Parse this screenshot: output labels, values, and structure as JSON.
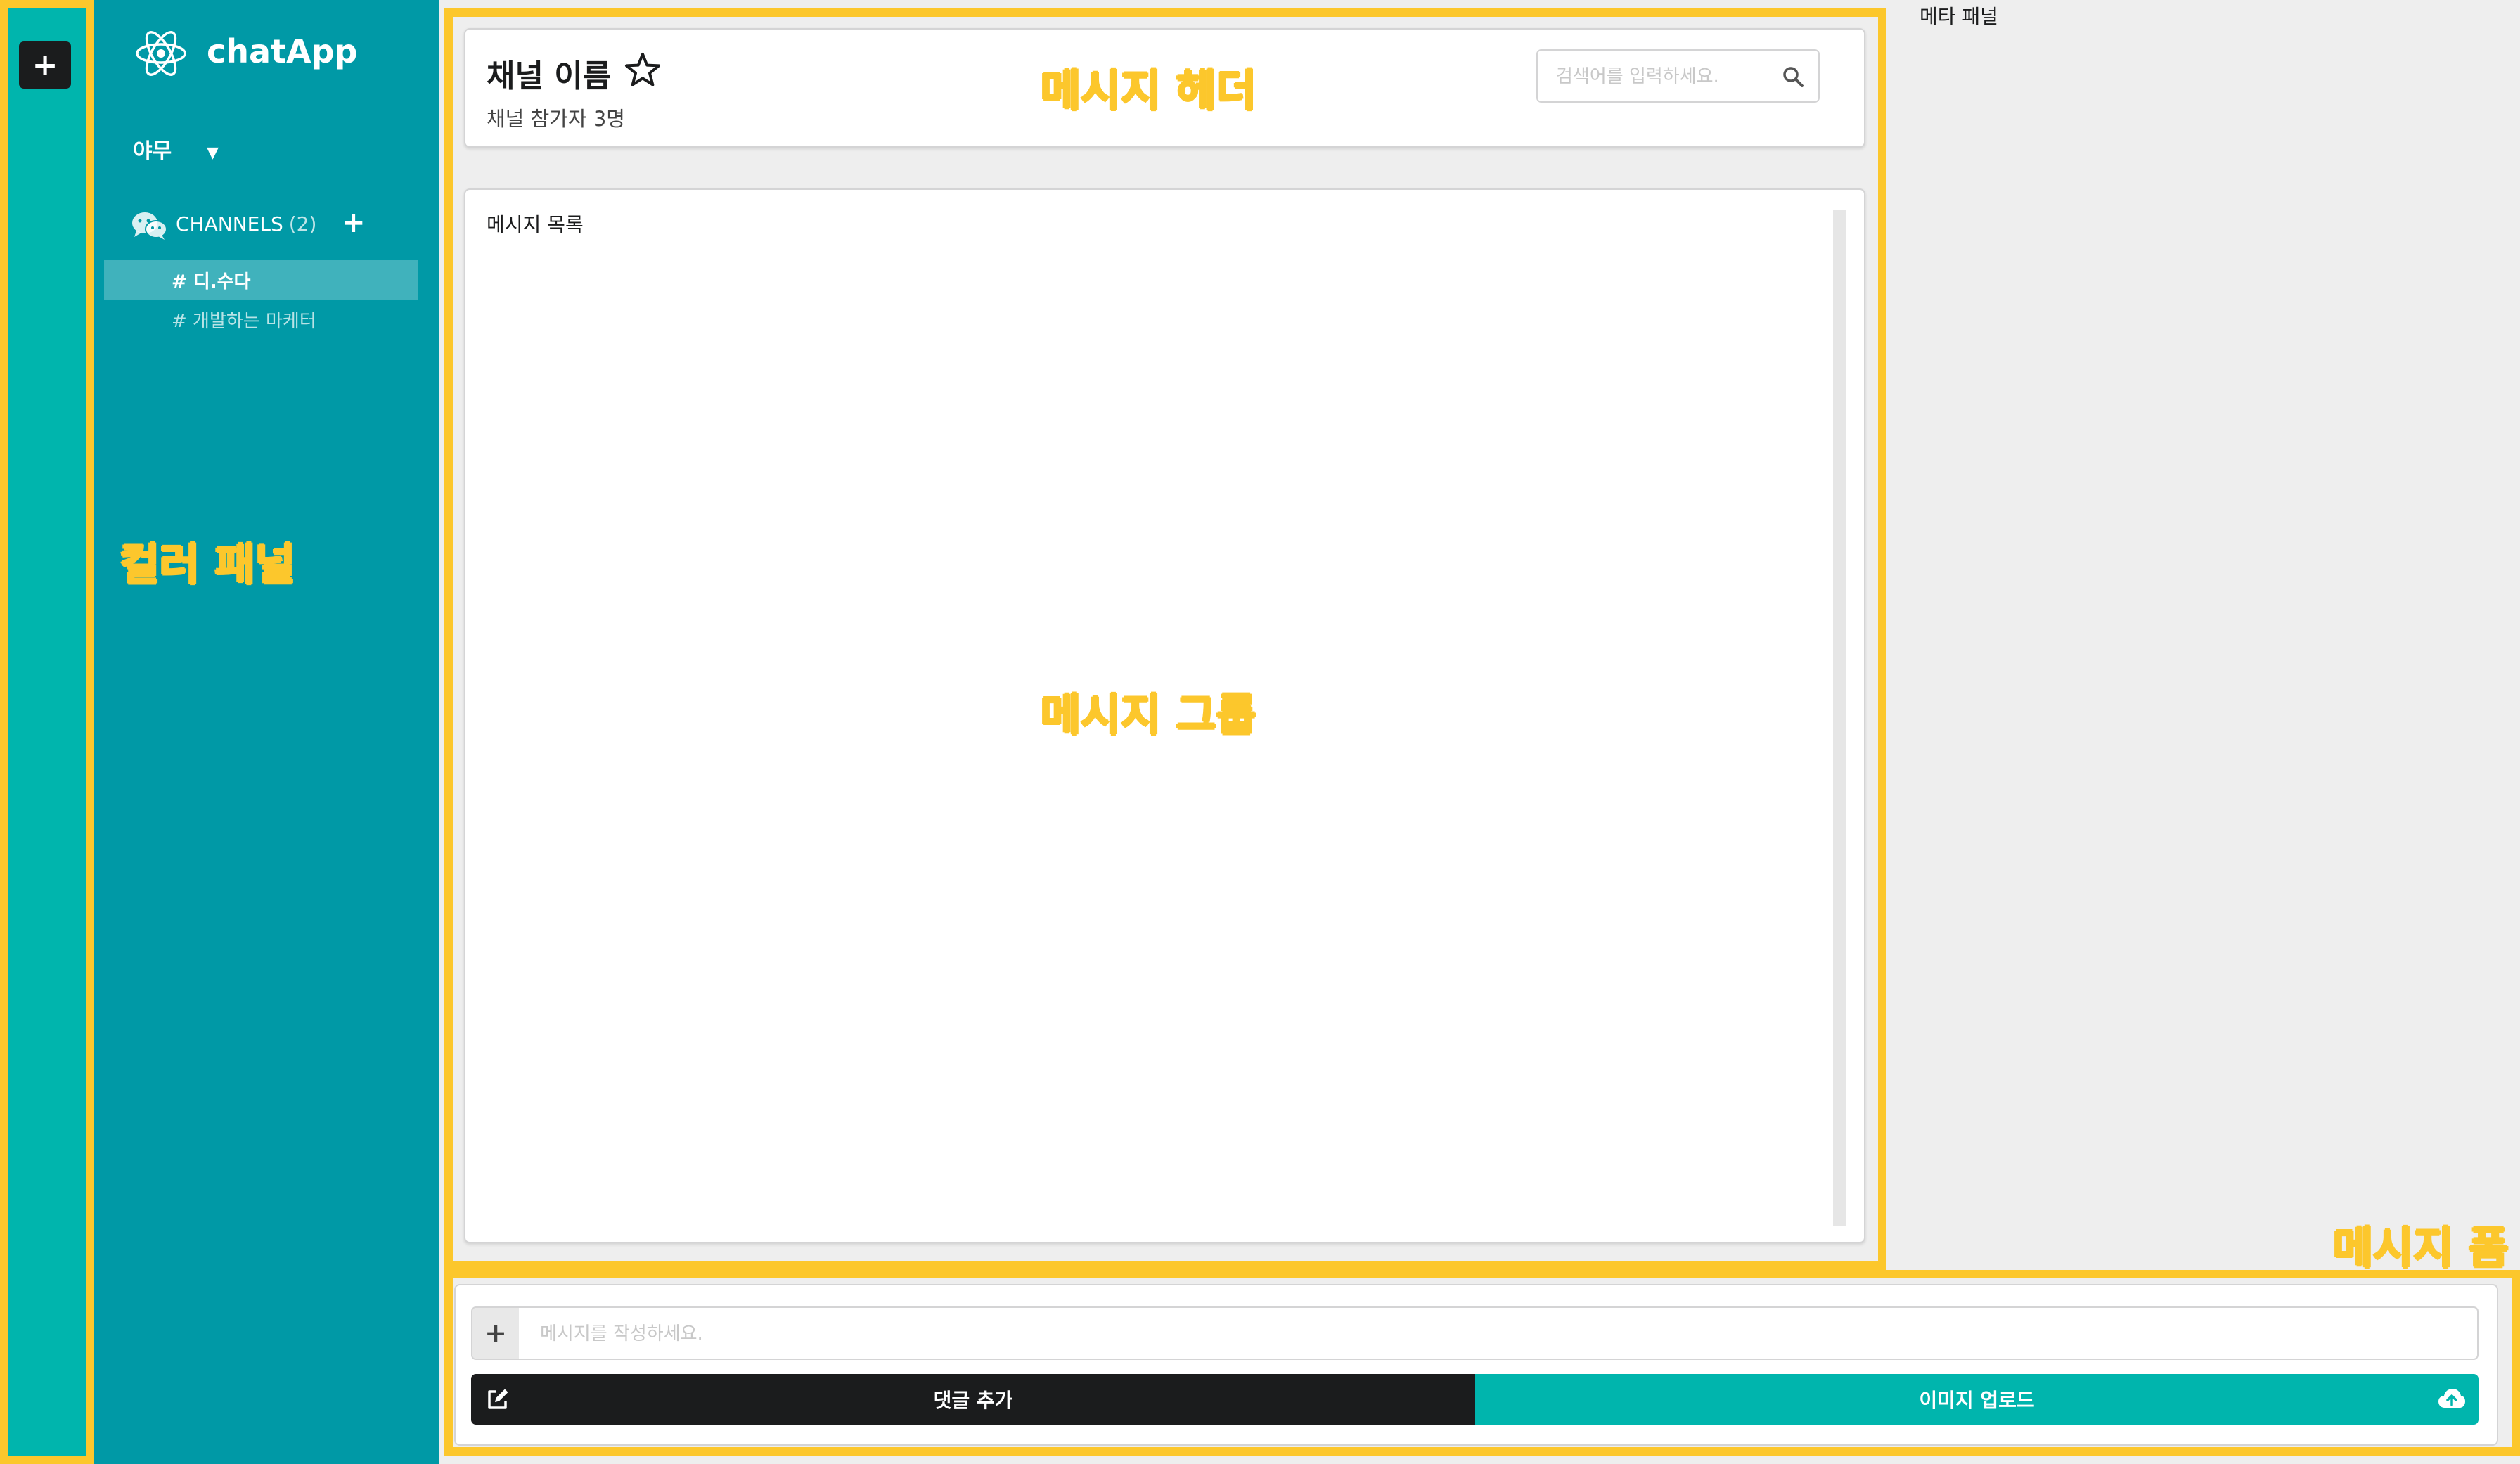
{
  "colors": {
    "color_panel": "#00b5ad",
    "side_panel": "#0099a6",
    "dark_button": "#1b1c1d",
    "accent_teal": "#00b5ad",
    "annotation": "#fcc72c",
    "background": "#eeeeee"
  },
  "color_panel": {
    "add_button": "+"
  },
  "side_panel": {
    "app_title": "chatApp",
    "logo_icon": "react-atom-icon",
    "user": {
      "name": "야무",
      "dropdown_icon": "caret-down-icon"
    },
    "channels": {
      "icon": "wechat-icon",
      "heading": "CHANNELS",
      "count": "(2)",
      "add_button": "+",
      "items": [
        {
          "label": "# 디.수다",
          "active": true
        },
        {
          "label": "# 개발하는 마케터",
          "active": false
        }
      ]
    }
  },
  "message_header": {
    "channel_name": "채널 이름",
    "star_icon": "star-outline-icon",
    "participants": "채널 참가자 3명",
    "search": {
      "placeholder": "검색어를 입력하세요.",
      "icon": "search-icon"
    }
  },
  "messages": {
    "title": "메시지 목록"
  },
  "meta_panel": {
    "label": "메타 패널"
  },
  "message_form": {
    "add_button": "+",
    "input_placeholder": "메시지를 작성하세요.",
    "add_comment_label": "댓글 추가",
    "add_comment_icon": "edit-icon",
    "upload_image_label": "이미지 업로드",
    "upload_image_icon": "cloud-upload-icon"
  },
  "annotations": {
    "color_panel": "컬러 패널",
    "message_header": "메시지 헤더",
    "message_group": "메시지 그룹",
    "message_form": "메시지 폼"
  }
}
